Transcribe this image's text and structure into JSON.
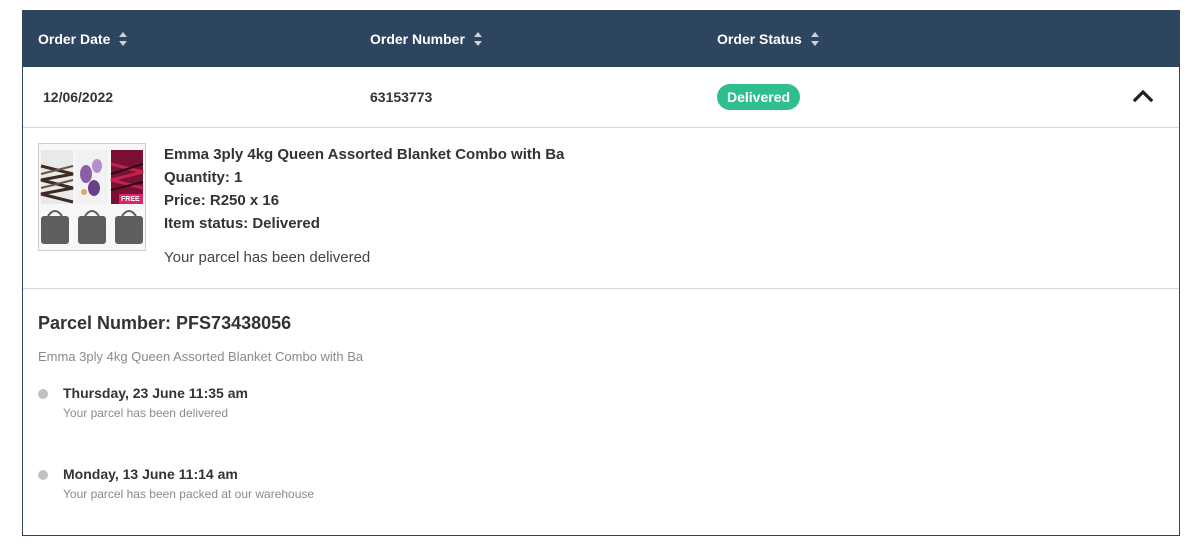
{
  "table": {
    "headers": [
      {
        "label": "Order Date"
      },
      {
        "label": "Order Number"
      },
      {
        "label": "Order Status"
      }
    ]
  },
  "order": {
    "date": "12/06/2022",
    "number": "63153773",
    "status": "Delivered"
  },
  "item": {
    "name": "Emma 3ply 4kg Queen Assorted Blanket Combo with Ba",
    "quantity": "Quantity: 1",
    "price": "Price: R250 x 16",
    "status": "Item status: Delivered",
    "message": "Your parcel has been delivered",
    "thumb_badge": "FREE"
  },
  "parcel": {
    "title": "Parcel Number: PFS73438056",
    "subtitle": "Emma 3ply 4kg Queen Assorted Blanket Combo with Ba",
    "events": [
      {
        "title": "Thursday, 23 June 11:35 am",
        "desc": "Your parcel has been delivered"
      },
      {
        "title": "Monday, 13 June 11:14 am",
        "desc": "Your parcel has been packed at our warehouse"
      }
    ]
  },
  "colors": {
    "header_bg": "#2e4560",
    "status_badge": "#2fbf8f",
    "timeline_dot": "#c2c2c2"
  },
  "icons": {
    "sort": "sort-icon",
    "collapse": "chevron-up-icon"
  }
}
